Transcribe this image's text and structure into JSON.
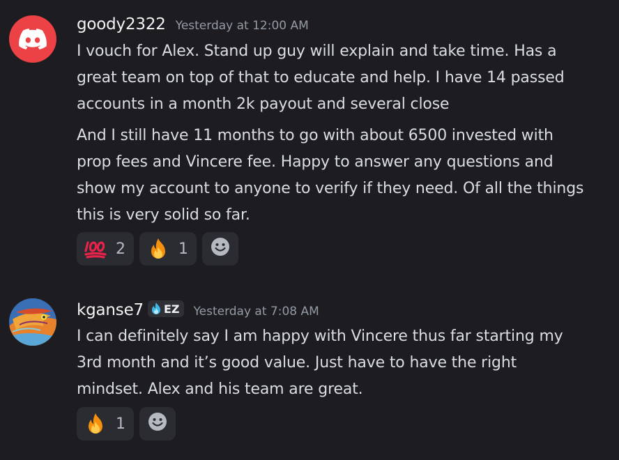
{
  "messages": [
    {
      "username": "goody2322",
      "timestamp": "Yesterday at 12:00 AM",
      "avatar_icon": "discord-logo-icon",
      "paragraphs": [
        [
          "I vouch for Alex. Stand up guy will explain and take time. Has a",
          "great team on top of that to educate and help. I have 14 passed",
          "accounts in a month 2k payout and several close"
        ],
        [
          "And I still have 11 months to go with about 6500 invested with",
          "prop fees and Vincere fee. Happy to answer any questions and",
          "show my account to anyone to verify if they need. Of all the things",
          "this is very solid so far."
        ]
      ],
      "reactions": [
        {
          "emoji": "100-icon",
          "count": "2"
        },
        {
          "emoji": "fire-icon",
          "count": "1"
        }
      ]
    },
    {
      "username": "kganse7",
      "tag": "EZ",
      "timestamp": "Yesterday at 7:08 AM",
      "avatar_icon": "dragon-avatar",
      "paragraphs": [
        [
          "I can definitely say I am happy with Vincere thus far starting my",
          "3rd month and it’s good value. Just have to have the right",
          "mindset. Alex and his team are great."
        ]
      ],
      "reactions": [
        {
          "emoji": "fire-icon",
          "count": "1"
        }
      ]
    }
  ],
  "colors": {
    "background": "#1c1c21",
    "discord_red": "#ed4245",
    "reaction_bg": "#2b2c31"
  }
}
